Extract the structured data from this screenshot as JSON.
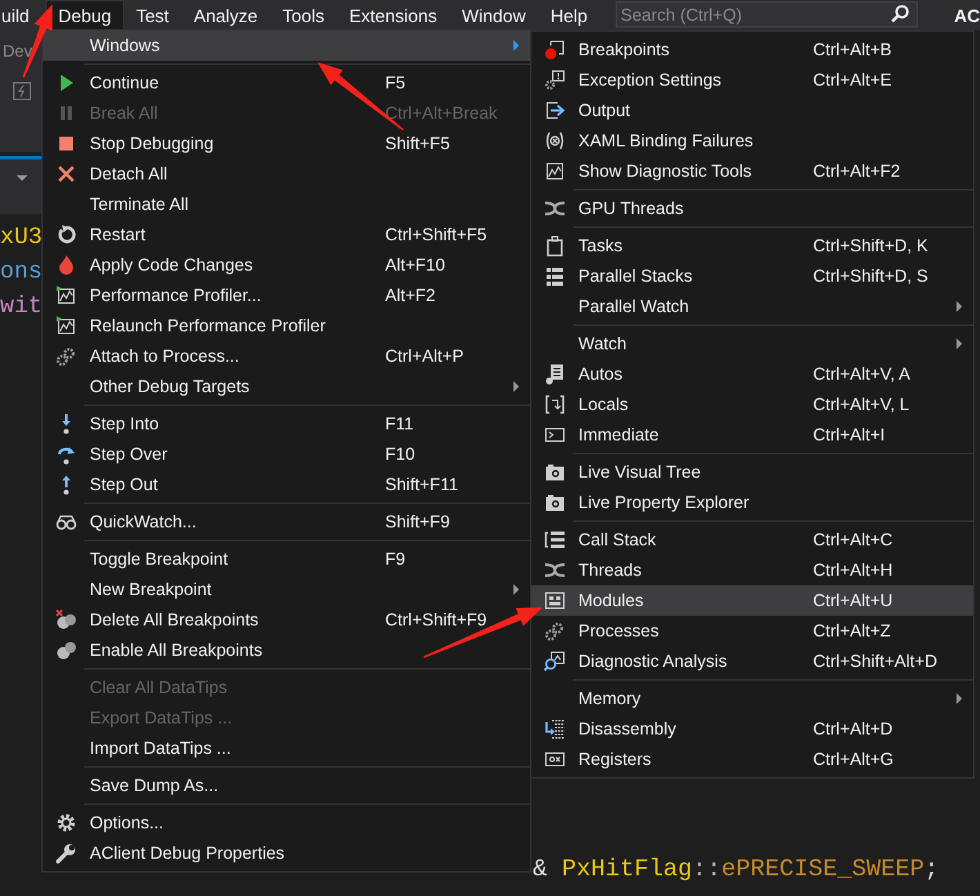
{
  "menubar": {
    "items": [
      {
        "label": "uild",
        "selected": false
      },
      {
        "label": "Debug",
        "selected": true
      },
      {
        "label": "Test",
        "selected": false
      },
      {
        "label": "Analyze",
        "selected": false
      },
      {
        "label": "Tools",
        "selected": false
      },
      {
        "label": "Extensions",
        "selected": false
      },
      {
        "label": "Window",
        "selected": false
      },
      {
        "label": "Help",
        "selected": false
      }
    ],
    "search": {
      "placeholder": "Search (Ctrl+Q)"
    },
    "account_fragment": "AC"
  },
  "toolbar_fragment": "Dev",
  "code_fragments": [
    {
      "text": "xU3",
      "color": "#e8c810"
    },
    {
      "text": "ons",
      "color": "#569cd6"
    },
    {
      "text": "wit",
      "color": "#c586c0"
    }
  ],
  "code_line": [
    {
      "text": "&",
      "color": "#dcdcdc"
    },
    {
      "text": " PxHitFlag",
      "color": "#e8c810"
    },
    {
      "text": "::",
      "color": "#b4b4b4"
    },
    {
      "text": "ePRECISE_SWEEP",
      "color": "#c58a2a"
    },
    {
      "text": ";",
      "color": "#dcdcdc"
    }
  ],
  "debug_menu": {
    "items": [
      {
        "kind": "item",
        "label": "Windows",
        "disabled": false,
        "submenu": true,
        "selected": true
      },
      {
        "kind": "separator"
      },
      {
        "kind": "item",
        "label": "Continue",
        "shortcut": "F5",
        "disabled": false,
        "submenu": false,
        "selected": false
      },
      {
        "kind": "item",
        "label": "Break All",
        "shortcut": "Ctrl+Alt+Break",
        "disabled": true,
        "submenu": false,
        "selected": false
      },
      {
        "kind": "item",
        "label": "Stop Debugging",
        "shortcut": "Shift+F5",
        "disabled": false,
        "submenu": false,
        "selected": false
      },
      {
        "kind": "item",
        "label": "Detach All",
        "disabled": false,
        "submenu": false,
        "selected": false
      },
      {
        "kind": "item",
        "label": "Terminate All",
        "disabled": false,
        "submenu": false,
        "selected": false
      },
      {
        "kind": "item",
        "label": "Restart",
        "shortcut": "Ctrl+Shift+F5",
        "disabled": false,
        "submenu": false,
        "selected": false
      },
      {
        "kind": "item",
        "label": "Apply Code Changes",
        "shortcut": "Alt+F10",
        "disabled": false,
        "submenu": false,
        "selected": false
      },
      {
        "kind": "item",
        "label": "Performance Profiler...",
        "shortcut": "Alt+F2",
        "disabled": false,
        "submenu": false,
        "selected": false
      },
      {
        "kind": "item",
        "label": "Relaunch Performance Profiler",
        "disabled": false,
        "submenu": false,
        "selected": false
      },
      {
        "kind": "item",
        "label": "Attach to Process...",
        "shortcut": "Ctrl+Alt+P",
        "disabled": false,
        "submenu": false,
        "selected": false
      },
      {
        "kind": "item",
        "label": "Other Debug Targets",
        "disabled": false,
        "submenu": true,
        "selected": false
      },
      {
        "kind": "separator"
      },
      {
        "kind": "item",
        "label": "Step Into",
        "shortcut": "F11",
        "disabled": false,
        "submenu": false,
        "selected": false
      },
      {
        "kind": "item",
        "label": "Step Over",
        "shortcut": "F10",
        "disabled": false,
        "submenu": false,
        "selected": false
      },
      {
        "kind": "item",
        "label": "Step Out",
        "shortcut": "Shift+F11",
        "disabled": false,
        "submenu": false,
        "selected": false
      },
      {
        "kind": "separator"
      },
      {
        "kind": "item",
        "label": "QuickWatch...",
        "shortcut": "Shift+F9",
        "disabled": false,
        "submenu": false,
        "selected": false
      },
      {
        "kind": "separator"
      },
      {
        "kind": "item",
        "label": "Toggle Breakpoint",
        "shortcut": "F9",
        "disabled": false,
        "submenu": false,
        "selected": false
      },
      {
        "kind": "item",
        "label": "New Breakpoint",
        "disabled": false,
        "submenu": true,
        "selected": false
      },
      {
        "kind": "item",
        "label": "Delete All Breakpoints",
        "shortcut": "Ctrl+Shift+F9",
        "disabled": false,
        "submenu": false,
        "selected": false
      },
      {
        "kind": "item",
        "label": "Enable All Breakpoints",
        "disabled": false,
        "submenu": false,
        "selected": false
      },
      {
        "kind": "separator"
      },
      {
        "kind": "item",
        "label": "Clear All DataTips",
        "disabled": true,
        "submenu": false,
        "selected": false
      },
      {
        "kind": "item",
        "label": "Export DataTips ...",
        "disabled": true,
        "submenu": false,
        "selected": false
      },
      {
        "kind": "item",
        "label": "Import DataTips ...",
        "disabled": false,
        "submenu": false,
        "selected": false
      },
      {
        "kind": "separator"
      },
      {
        "kind": "item",
        "label": "Save Dump As...",
        "disabled": false,
        "submenu": false,
        "selected": false
      },
      {
        "kind": "separator"
      },
      {
        "kind": "item",
        "label": "Options...",
        "disabled": false,
        "submenu": false,
        "selected": false
      },
      {
        "kind": "item",
        "label": "AClient Debug Properties",
        "disabled": false,
        "submenu": false,
        "selected": false
      }
    ]
  },
  "windows_submenu": {
    "items": [
      {
        "kind": "item",
        "label": "Breakpoints",
        "shortcut": "Ctrl+Alt+B",
        "disabled": false,
        "submenu": false,
        "selected": false
      },
      {
        "kind": "item",
        "label": "Exception Settings",
        "shortcut": "Ctrl+Alt+E",
        "disabled": false,
        "submenu": false,
        "selected": false
      },
      {
        "kind": "item",
        "label": "Output",
        "disabled": false,
        "submenu": false,
        "selected": false
      },
      {
        "kind": "item",
        "label": "XAML Binding Failures",
        "disabled": false,
        "submenu": false,
        "selected": false
      },
      {
        "kind": "item",
        "label": "Show Diagnostic Tools",
        "shortcut": "Ctrl+Alt+F2",
        "disabled": false,
        "submenu": false,
        "selected": false
      },
      {
        "kind": "separator"
      },
      {
        "kind": "item",
        "label": "GPU Threads",
        "disabled": false,
        "submenu": false,
        "selected": false
      },
      {
        "kind": "separator"
      },
      {
        "kind": "item",
        "label": "Tasks",
        "shortcut": "Ctrl+Shift+D, K",
        "disabled": false,
        "submenu": false,
        "selected": false
      },
      {
        "kind": "item",
        "label": "Parallel Stacks",
        "shortcut": "Ctrl+Shift+D, S",
        "disabled": false,
        "submenu": false,
        "selected": false
      },
      {
        "kind": "item",
        "label": "Parallel Watch",
        "disabled": false,
        "submenu": true,
        "selected": false
      },
      {
        "kind": "separator"
      },
      {
        "kind": "item",
        "label": "Watch",
        "disabled": false,
        "submenu": true,
        "selected": false
      },
      {
        "kind": "item",
        "label": "Autos",
        "shortcut": "Ctrl+Alt+V, A",
        "disabled": false,
        "submenu": false,
        "selected": false
      },
      {
        "kind": "item",
        "label": "Locals",
        "shortcut": "Ctrl+Alt+V, L",
        "disabled": false,
        "submenu": false,
        "selected": false
      },
      {
        "kind": "item",
        "label": "Immediate",
        "shortcut": "Ctrl+Alt+I",
        "disabled": false,
        "submenu": false,
        "selected": false
      },
      {
        "kind": "separator"
      },
      {
        "kind": "item",
        "label": "Live Visual Tree",
        "disabled": false,
        "submenu": false,
        "selected": false
      },
      {
        "kind": "item",
        "label": "Live Property Explorer",
        "disabled": false,
        "submenu": false,
        "selected": false
      },
      {
        "kind": "separator"
      },
      {
        "kind": "item",
        "label": "Call Stack",
        "shortcut": "Ctrl+Alt+C",
        "disabled": false,
        "submenu": false,
        "selected": false
      },
      {
        "kind": "item",
        "label": "Threads",
        "shortcut": "Ctrl+Alt+H",
        "disabled": false,
        "submenu": false,
        "selected": false
      },
      {
        "kind": "item",
        "label": "Modules",
        "shortcut": "Ctrl+Alt+U",
        "disabled": false,
        "submenu": false,
        "selected": true
      },
      {
        "kind": "item",
        "label": "Processes",
        "shortcut": "Ctrl+Alt+Z",
        "disabled": false,
        "submenu": false,
        "selected": false
      },
      {
        "kind": "item",
        "label": "Diagnostic Analysis",
        "shortcut": "Ctrl+Shift+Alt+D",
        "disabled": false,
        "submenu": false,
        "selected": false
      },
      {
        "kind": "separator"
      },
      {
        "kind": "item",
        "label": "Memory",
        "disabled": false,
        "submenu": true,
        "selected": false
      },
      {
        "kind": "item",
        "label": "Disassembly",
        "shortcut": "Ctrl+Alt+D",
        "disabled": false,
        "submenu": false,
        "selected": false
      },
      {
        "kind": "item",
        "label": "Registers",
        "shortcut": "Ctrl+Alt+G",
        "disabled": false,
        "submenu": false,
        "selected": false
      }
    ]
  }
}
